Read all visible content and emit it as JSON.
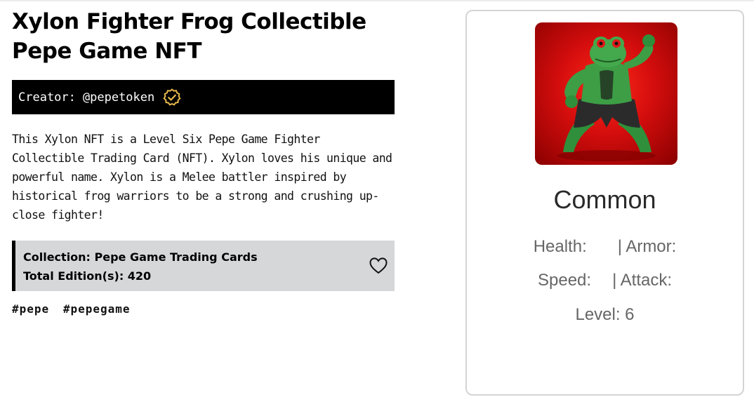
{
  "title_line1": "Xylon Fighter Frog Collectible",
  "title_line2": "Pepe Game NFT",
  "creator": {
    "label": "Creator:",
    "handle": "@pepetoken",
    "badge_icon": "verified-check-icon",
    "badge_color": "#e6b84c"
  },
  "description": "This Xylon NFT is a Level Six Pepe Game Fighter Collectible Trading Card (NFT). Xylon loves his unique and powerful name. Xylon is a Melee battler inspired by historical frog warriors to be a strong and crushing up-close fighter!",
  "collection": {
    "name_line": "Collection: Pepe Game Trading Cards",
    "edition_line": "Total Edition(s): 420",
    "favorite_icon": "heart-icon"
  },
  "tags": [
    "#pepe",
    "#pepegame"
  ],
  "card": {
    "rarity": "Common",
    "health_label": "Health:",
    "armor_label": "| Armor:",
    "speed_label": "Speed:",
    "attack_label": "| Attack:",
    "level_text": "Level: 6",
    "image_background": "#d40d0d"
  }
}
